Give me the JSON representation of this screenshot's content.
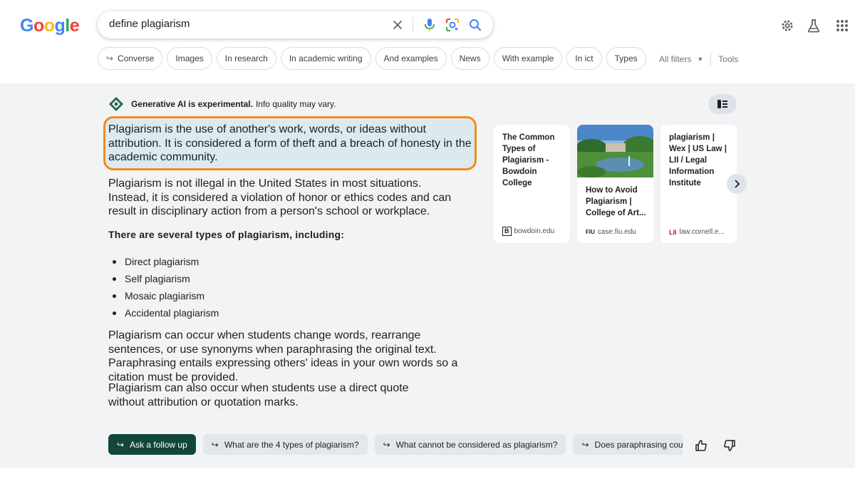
{
  "header": {
    "logo": [
      "G",
      "o",
      "o",
      "g",
      "l",
      "e"
    ],
    "logo_colors": [
      "#4285F4",
      "#EA4335",
      "#FBBC05",
      "#4285F4",
      "#34A853",
      "#EA4335"
    ],
    "search_value": "define plagiarism",
    "icons": [
      "close-icon",
      "mic-icon",
      "lens-icon",
      "search-icon",
      "settings-icon",
      "labs-icon",
      "apps-icon"
    ]
  },
  "chips": [
    {
      "label": "Converse",
      "arrow": true
    },
    {
      "label": "Images"
    },
    {
      "label": "In research"
    },
    {
      "label": "In academic writing"
    },
    {
      "label": "And examples"
    },
    {
      "label": "News"
    },
    {
      "label": "With example"
    },
    {
      "label": "In ict"
    },
    {
      "label": "Types"
    }
  ],
  "filters": {
    "all_filters": "All filters",
    "tools": "Tools"
  },
  "ai": {
    "notice_bold": "Generative AI is experimental.",
    "notice_rest": "Info quality may vary.",
    "highlight": "Plagiarism is the use of another's work, words, or ideas without attribution. It is considered a form of theft and a breach of honesty in the academic community.",
    "para1": "Plagiarism is not illegal in the United States in most situations. Instead, it is considered a violation of honor or ethics codes and can result in disciplinary action from a person's school or workplace.",
    "types_heading": "There are several types of plagiarism, including:",
    "types": [
      "Direct plagiarism",
      "Self plagiarism",
      "Mosaic plagiarism",
      "Accidental plagiarism"
    ],
    "para2": "Plagiarism can occur when students change words, rearrange sentences, or use synonyms when paraphrasing the original text. Paraphrasing entails expressing others' ideas in your own words so a citation must be provided.",
    "para3": "Plagiarism can also occur when students use a direct quote without attribution or quotation marks."
  },
  "cards": [
    {
      "title": "The Common Types of Plagiarism - Bowdoin College",
      "source": "bowdoin.edu",
      "favicon": "B"
    },
    {
      "title": "How to Avoid Plagiarism | College of Art...",
      "source": "case.fiu.edu",
      "favicon": "FIU"
    },
    {
      "title": "plagiarism | Wex | US Law | LII / Legal Information Institute",
      "source": "law.cornell.e...",
      "favicon": "LII"
    }
  ],
  "followups": [
    {
      "label": "Ask a follow up"
    },
    {
      "label": "What are the 4 types of plagiarism?"
    },
    {
      "label": "What cannot be considered as plagiarism?"
    },
    {
      "label": "Does paraphrasing count as pl"
    }
  ],
  "colors": {
    "highlight_border": "#f28b1e",
    "followup_primary": "#11473a",
    "ai_background": "#f1f3f4"
  }
}
